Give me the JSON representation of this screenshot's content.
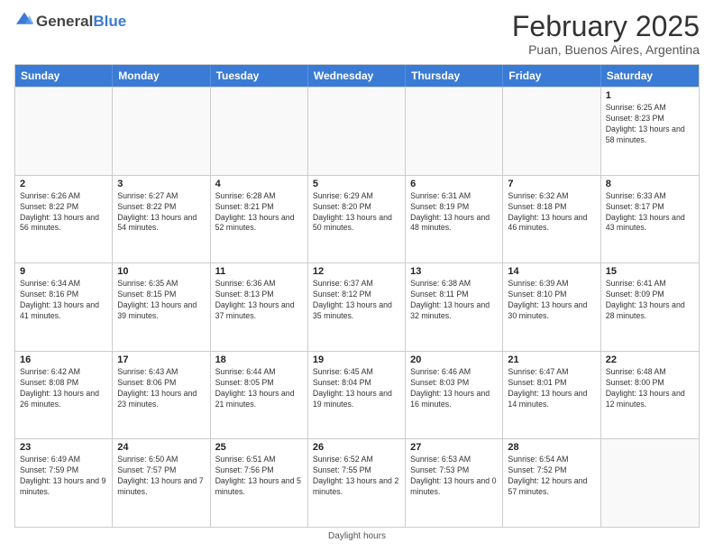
{
  "header": {
    "logo_general": "General",
    "logo_blue": "Blue",
    "title": "February 2025",
    "subtitle": "Puan, Buenos Aires, Argentina"
  },
  "days_of_week": [
    "Sunday",
    "Monday",
    "Tuesday",
    "Wednesday",
    "Thursday",
    "Friday",
    "Saturday"
  ],
  "weeks": [
    [
      {
        "day": "",
        "info": ""
      },
      {
        "day": "",
        "info": ""
      },
      {
        "day": "",
        "info": ""
      },
      {
        "day": "",
        "info": ""
      },
      {
        "day": "",
        "info": ""
      },
      {
        "day": "",
        "info": ""
      },
      {
        "day": "1",
        "info": "Sunrise: 6:25 AM\nSunset: 8:23 PM\nDaylight: 13 hours and 58 minutes."
      }
    ],
    [
      {
        "day": "2",
        "info": "Sunrise: 6:26 AM\nSunset: 8:22 PM\nDaylight: 13 hours and 56 minutes."
      },
      {
        "day": "3",
        "info": "Sunrise: 6:27 AM\nSunset: 8:22 PM\nDaylight: 13 hours and 54 minutes."
      },
      {
        "day": "4",
        "info": "Sunrise: 6:28 AM\nSunset: 8:21 PM\nDaylight: 13 hours and 52 minutes."
      },
      {
        "day": "5",
        "info": "Sunrise: 6:29 AM\nSunset: 8:20 PM\nDaylight: 13 hours and 50 minutes."
      },
      {
        "day": "6",
        "info": "Sunrise: 6:31 AM\nSunset: 8:19 PM\nDaylight: 13 hours and 48 minutes."
      },
      {
        "day": "7",
        "info": "Sunrise: 6:32 AM\nSunset: 8:18 PM\nDaylight: 13 hours and 46 minutes."
      },
      {
        "day": "8",
        "info": "Sunrise: 6:33 AM\nSunset: 8:17 PM\nDaylight: 13 hours and 43 minutes."
      }
    ],
    [
      {
        "day": "9",
        "info": "Sunrise: 6:34 AM\nSunset: 8:16 PM\nDaylight: 13 hours and 41 minutes."
      },
      {
        "day": "10",
        "info": "Sunrise: 6:35 AM\nSunset: 8:15 PM\nDaylight: 13 hours and 39 minutes."
      },
      {
        "day": "11",
        "info": "Sunrise: 6:36 AM\nSunset: 8:13 PM\nDaylight: 13 hours and 37 minutes."
      },
      {
        "day": "12",
        "info": "Sunrise: 6:37 AM\nSunset: 8:12 PM\nDaylight: 13 hours and 35 minutes."
      },
      {
        "day": "13",
        "info": "Sunrise: 6:38 AM\nSunset: 8:11 PM\nDaylight: 13 hours and 32 minutes."
      },
      {
        "day": "14",
        "info": "Sunrise: 6:39 AM\nSunset: 8:10 PM\nDaylight: 13 hours and 30 minutes."
      },
      {
        "day": "15",
        "info": "Sunrise: 6:41 AM\nSunset: 8:09 PM\nDaylight: 13 hours and 28 minutes."
      }
    ],
    [
      {
        "day": "16",
        "info": "Sunrise: 6:42 AM\nSunset: 8:08 PM\nDaylight: 13 hours and 26 minutes."
      },
      {
        "day": "17",
        "info": "Sunrise: 6:43 AM\nSunset: 8:06 PM\nDaylight: 13 hours and 23 minutes."
      },
      {
        "day": "18",
        "info": "Sunrise: 6:44 AM\nSunset: 8:05 PM\nDaylight: 13 hours and 21 minutes."
      },
      {
        "day": "19",
        "info": "Sunrise: 6:45 AM\nSunset: 8:04 PM\nDaylight: 13 hours and 19 minutes."
      },
      {
        "day": "20",
        "info": "Sunrise: 6:46 AM\nSunset: 8:03 PM\nDaylight: 13 hours and 16 minutes."
      },
      {
        "day": "21",
        "info": "Sunrise: 6:47 AM\nSunset: 8:01 PM\nDaylight: 13 hours and 14 minutes."
      },
      {
        "day": "22",
        "info": "Sunrise: 6:48 AM\nSunset: 8:00 PM\nDaylight: 13 hours and 12 minutes."
      }
    ],
    [
      {
        "day": "23",
        "info": "Sunrise: 6:49 AM\nSunset: 7:59 PM\nDaylight: 13 hours and 9 minutes."
      },
      {
        "day": "24",
        "info": "Sunrise: 6:50 AM\nSunset: 7:57 PM\nDaylight: 13 hours and 7 minutes."
      },
      {
        "day": "25",
        "info": "Sunrise: 6:51 AM\nSunset: 7:56 PM\nDaylight: 13 hours and 5 minutes."
      },
      {
        "day": "26",
        "info": "Sunrise: 6:52 AM\nSunset: 7:55 PM\nDaylight: 13 hours and 2 minutes."
      },
      {
        "day": "27",
        "info": "Sunrise: 6:53 AM\nSunset: 7:53 PM\nDaylight: 13 hours and 0 minutes."
      },
      {
        "day": "28",
        "info": "Sunrise: 6:54 AM\nSunset: 7:52 PM\nDaylight: 12 hours and 57 minutes."
      },
      {
        "day": "",
        "info": ""
      }
    ]
  ],
  "footer": "Daylight hours"
}
